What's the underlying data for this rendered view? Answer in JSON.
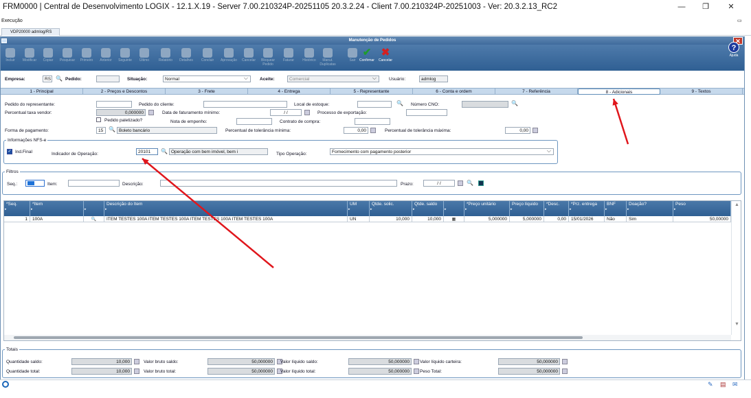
{
  "window": {
    "title": "FRM0000 | Central de Desenvolvimento LOGIX  -  12.1.X.19 - Server 7.00.210324P-20251105 20.3.2.24 - Client 7.00.210324P-20251003 - Ver: 20.3.2.13_RC2",
    "minimize": "—",
    "maximize": "❐",
    "close": "✕"
  },
  "menu": {
    "label": "Execução"
  },
  "doc_tab": {
    "label": "VDP20000 admlog/RS"
  },
  "app": {
    "title": "Manutenção de Pedidos"
  },
  "toolbar": [
    {
      "label": "Incluir",
      "enabled": false
    },
    {
      "label": "Modificar",
      "enabled": false
    },
    {
      "label": "Copiar",
      "enabled": false
    },
    {
      "label": "Pesquisar",
      "enabled": false
    },
    {
      "label": "Primeiro",
      "enabled": false
    },
    {
      "label": "Anterior",
      "enabled": false
    },
    {
      "label": "Seguinte",
      "enabled": false
    },
    {
      "label": "Último",
      "enabled": false
    },
    {
      "label": "Relatório",
      "enabled": false
    },
    {
      "label": "Detalhes",
      "enabled": false
    },
    {
      "label": "Concluir",
      "enabled": false
    },
    {
      "label": "Aprovação",
      "enabled": false
    },
    {
      "label": "Cancelar",
      "enabled": false
    },
    {
      "label": "Bloquear Pedido",
      "enabled": false
    },
    {
      "label": "Faturar",
      "enabled": false
    },
    {
      "label": "Histórico",
      "enabled": false
    },
    {
      "label": "Manut. Duplicatas",
      "enabled": false
    },
    {
      "label": "Sair",
      "enabled": false
    },
    {
      "label": "Confirmar",
      "enabled": true,
      "glyph": "✔",
      "color": "#1f9b2e"
    },
    {
      "label": "Cancelar",
      "enabled": true,
      "glyph": "✖",
      "color": "#d42020"
    }
  ],
  "help": {
    "label": "Ajuda",
    "glyph": "?"
  },
  "header_fields": {
    "empresa_label": "Empresa:",
    "empresa_value": "RS",
    "pedido_label": "Pedido:",
    "pedido_value": "",
    "situacao_label": "Situação:",
    "situacao_value": "Normal",
    "aceite_label": "Aceite:",
    "aceite_value": "Comercial",
    "usuario_label": "Usuário:",
    "usuario_value": "admlog"
  },
  "tabs": [
    {
      "label": "1 - Principal"
    },
    {
      "label": "2 - Preços e Descontos"
    },
    {
      "label": "3 - Frete"
    },
    {
      "label": "4 - Entrega"
    },
    {
      "label": "5 - Representante"
    },
    {
      "label": "6 - Conta e ordem"
    },
    {
      "label": "7 - Referência"
    },
    {
      "label": "8 - Adicionais",
      "selected": true
    },
    {
      "label": "9 - Textos"
    }
  ],
  "form": {
    "pedido_representante": "Pedido do representante:",
    "pedido_cliente": "Pedido do cliente:",
    "local_estoque": "Local de estoque:",
    "numero_cno": "Número CNO:",
    "percentual_taxa_vendor": "Percentual taxa vendor:",
    "percentual_taxa_vendor_value": "0,000000",
    "data_faturamento_minimo": "Data de faturamento mínimo:",
    "data_faturamento_value": "/ /",
    "processo_exportacao": "Processo de exportação:",
    "pedido_paletizado": "Pedido paletizado?",
    "nota_empenho": "Nota de empenho:",
    "contrato_compra": "Contrato de compra:",
    "forma_pagamento": "Forma de pagamento:",
    "forma_pagamento_code": "15",
    "forma_pagamento_desc": "Boleto bancário",
    "perc_tolerancia_minima": "Percentual de tolerância mínima:",
    "perc_tolerancia_minima_value": "0,00",
    "perc_tolerancia_maxima": "Percentual de tolerância máxima:",
    "perc_tolerancia_maxima_value": "0,00"
  },
  "nfse": {
    "legend": "Informações NFS-e",
    "ind_final_label": "Ind.Final",
    "ind_final_checked": true,
    "indicador_label": "Indicador de Operação:",
    "indicador_code": "20101",
    "indicador_desc": "Operação com bem imóvel, bem i",
    "tipo_operacao_label": "Tipo Operação:",
    "tipo_operacao_value": "Fornecimento com pagamento posterior"
  },
  "filtros": {
    "legend": "Filtros",
    "seq_label": "Seq.:",
    "item_label": "Item:",
    "descricao_label": "Descrição:",
    "prazo_label": "Prazo:",
    "prazo_value": "/ /"
  },
  "grid": {
    "headers": [
      "*Seq.",
      "*Item",
      "",
      "Descrição do Item",
      "UM",
      "Qtde. solic.",
      "Qtde. saldo",
      "",
      "*Preço unitário",
      "Preço líquido",
      "*Desc.",
      "*Prz. entrega",
      "BNF",
      "Doação?",
      "Peso"
    ],
    "rows": [
      [
        "1",
        "100A",
        "🔍",
        "ITEM TESTES 100A ITEM TESTES 100A ITEM TESTES 100A ITEM TESTES 100A",
        "UN",
        "10,000",
        "10,000",
        "▦",
        "5,000000",
        "5,000000",
        "0,00",
        "15/01/2026",
        "Não",
        "Sim",
        "50,00000"
      ]
    ]
  },
  "totais": {
    "legend": "Totais",
    "quantidade_saldo_label": "Quantidade saldo:",
    "quantidade_saldo": "10,000",
    "valor_bruto_saldo_label": "Valor bruto saldo:",
    "valor_bruto_saldo": "50,000000",
    "valor_liquido_saldo_label": "Valor líquido saldo:",
    "valor_liquido_saldo": "50,000000",
    "valor_liquido_carteira_label": "Valor líquido carteira:",
    "valor_liquido_carteira": "50,000000",
    "quantidade_total_label": "Quantidade total:",
    "quantidade_total": "10,000",
    "valor_bruto_total_label": "Valor bruto total:",
    "valor_bruto_total": "50,000000",
    "valor_liquido_total_label": "Valor líquido total:",
    "valor_liquido_total": "50,000000",
    "peso_total_label": "Peso Total:",
    "peso_total": "50,000000"
  },
  "annotation": {
    "arrow_color": "#e0161c"
  }
}
